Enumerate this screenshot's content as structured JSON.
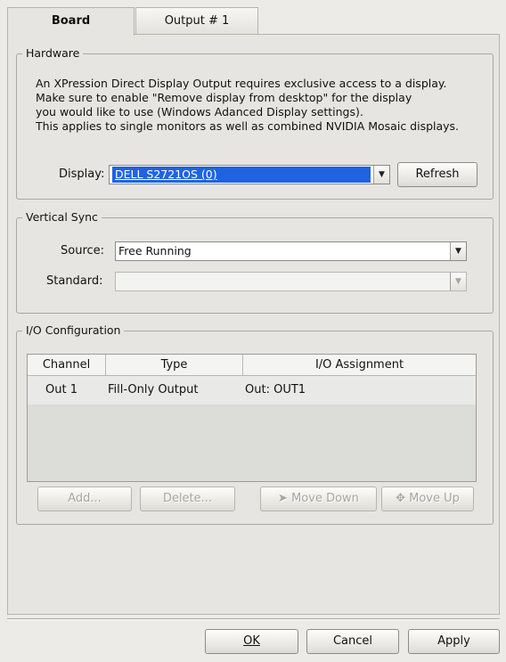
{
  "tabs": [
    {
      "label": "Board",
      "active": true
    },
    {
      "label": "Output # 1",
      "active": false
    }
  ],
  "hardware": {
    "title": "Hardware",
    "lines": [
      "An XPression Direct Display Output requires exclusive access to a display.",
      "Make sure to enable \"Remove display from desktop\" for the display",
      "you would like to use (Windows Adanced Display settings).",
      "This applies to single monitors as well as combined NVIDIA Mosaic displays."
    ],
    "display_label": "Display:",
    "display_value": "DELL S2721OS (0)",
    "refresh_label": "Refresh"
  },
  "vsync": {
    "title": "Vertical Sync",
    "source_label": "Source:",
    "source_value": "Free Running",
    "standard_label": "Standard:",
    "standard_value": ""
  },
  "io": {
    "title": "I/O Configuration",
    "columns": [
      "Channel",
      "Type",
      "I/O Assignment"
    ],
    "rows": [
      {
        "channel": "Out 1",
        "type": "Fill-Only Output",
        "assignment": "Out: OUT1"
      }
    ],
    "buttons": {
      "add": "Add...",
      "delete": "Delete...",
      "move_down": "Move Down",
      "move_up": "Move Up"
    }
  },
  "footer": {
    "ok": "OK",
    "cancel": "Cancel",
    "apply": "Apply"
  },
  "colors": {
    "selection": "#1f63e0",
    "panel": "#e6e5e1"
  }
}
